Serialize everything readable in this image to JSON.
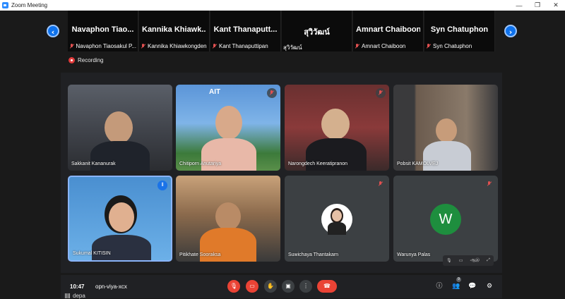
{
  "window": {
    "title": "Zoom Meeting",
    "minimize": "—",
    "restore": "❐",
    "close": "✕"
  },
  "strip": {
    "prev_label": "‹",
    "next_label": "›",
    "tiles": [
      {
        "display_name": "Navaphon  Tiao...",
        "label": "Navaphon Tiaosakul P..."
      },
      {
        "display_name": "Kannika  Khiawk...",
        "label": "Kannika Khiawkongden"
      },
      {
        "display_name": "Kant  Thanaputt...",
        "label": "Kant Thanaputtipan"
      },
      {
        "display_name": "สุวิวัฒน์",
        "label": "สุวิวัฒน์"
      },
      {
        "display_name": "Amnart Chaiboon",
        "label": "Amnart Chaiboon"
      },
      {
        "display_name": "Syn Chatuphon",
        "label": "Syn Chatuphon"
      }
    ]
  },
  "recording": {
    "label": "Recording"
  },
  "meeting": {
    "tiles": [
      {
        "name": "Sakkanit Kananurak"
      },
      {
        "name": "Chitiporn Anutariya",
        "logo": "AIT"
      },
      {
        "name": "Narongdech Keeratipranon"
      },
      {
        "name": "Pobsit KAMOLVEJ"
      },
      {
        "name": "Sukumal KITISIN"
      },
      {
        "name": "Pitikhate Sooraksa"
      },
      {
        "name": "Suwichaya Thantakarn"
      },
      {
        "name": "Warunya Palas",
        "initial": "W",
        "avatar_color": "#1e8e3e"
      }
    ],
    "time": "10:47",
    "code": "opn-viya-xcx",
    "people_count": "9",
    "mini_label": "ஆஇ"
  },
  "status": {
    "network_label": "depa"
  },
  "colors": {
    "accent": "#0e72ed",
    "danger": "#ea4335",
    "tile_bg": "#3c4043"
  }
}
